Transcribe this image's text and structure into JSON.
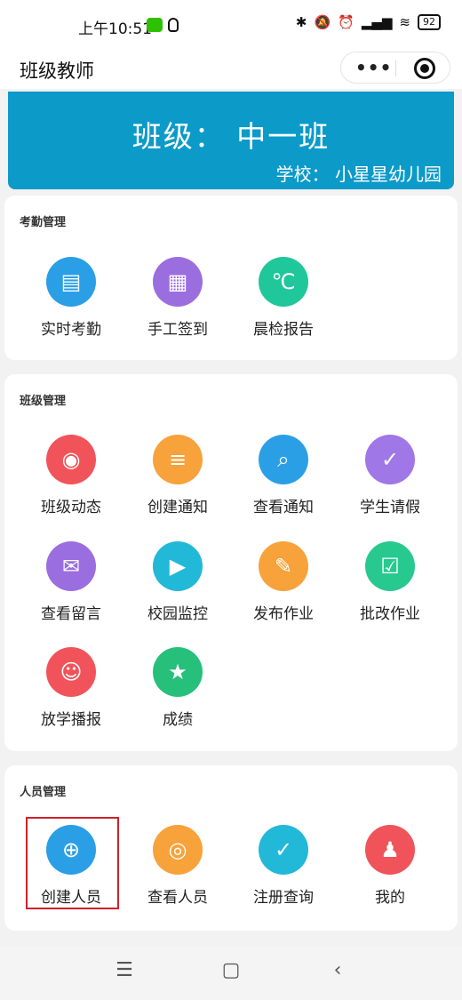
{
  "status": {
    "time": "上午10:51",
    "battery": "92"
  },
  "header": {
    "title": "班级教师",
    "menu_icon": "more-dots-icon",
    "close_icon": "target-circle-icon"
  },
  "banner": {
    "class_text": "班级： 中一班",
    "school_text": "学校： 小星星幼儿园",
    "color": "#0c9ac8"
  },
  "sections": [
    {
      "title": "考勤管理",
      "items": [
        {
          "label": "实时考勤",
          "icon": "calendar-check-icon",
          "color": "#2b9fe6"
        },
        {
          "label": "手工签到",
          "icon": "document-hand-icon",
          "color": "#9b6ee0"
        },
        {
          "label": "晨检报告",
          "icon": "thermometer-icon",
          "color": "#1fc79a"
        }
      ]
    },
    {
      "title": "班级管理",
      "items": [
        {
          "label": "班级动态",
          "icon": "aperture-icon",
          "color": "#f0545a"
        },
        {
          "label": "创建通知",
          "icon": "document-add-icon",
          "color": "#f7a23a"
        },
        {
          "label": "查看通知",
          "icon": "document-search-icon",
          "color": "#2b9fe6"
        },
        {
          "label": "学生请假",
          "icon": "leave-check-icon",
          "color": "#a077e6"
        },
        {
          "label": "查看留言",
          "icon": "message-search-icon",
          "color": "#9b6ee0"
        },
        {
          "label": "校园监控",
          "icon": "tv-play-icon",
          "color": "#22b8d8"
        },
        {
          "label": "发布作业",
          "icon": "pencil-icon",
          "color": "#f7a23a"
        },
        {
          "label": "批改作业",
          "icon": "document-check-icon",
          "color": "#27c98f"
        },
        {
          "label": "放学播报",
          "icon": "kids-running-icon",
          "color": "#f0545a"
        },
        {
          "label": "成绩",
          "icon": "star-award-icon",
          "color": "#27c07a"
        }
      ]
    },
    {
      "title": "人员管理",
      "items": [
        {
          "label": "创建人员",
          "icon": "user-add-icon",
          "color": "#2b9fe6"
        },
        {
          "label": "查看人员",
          "icon": "users-icon",
          "color": "#f7a23a"
        },
        {
          "label": "注册查询",
          "icon": "user-check-icon",
          "color": "#22b8d8"
        },
        {
          "label": "我的",
          "icon": "person-icon",
          "color": "#f0545a"
        }
      ]
    }
  ],
  "navbar": {
    "menu_icon": "menu-lines-icon",
    "home_icon": "square-home-icon",
    "back_icon": "back-chevron-icon"
  }
}
